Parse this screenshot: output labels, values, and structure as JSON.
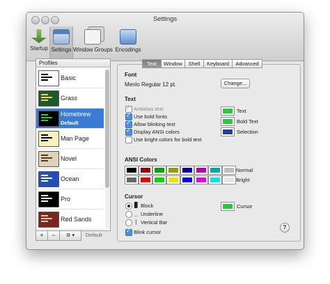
{
  "window": {
    "title": "Settings"
  },
  "toolbar": {
    "items": [
      {
        "label": "Startup",
        "icon": "startup-icon",
        "color": "#5a9a3a"
      },
      {
        "label": "Settings",
        "icon": "settings-icon",
        "color": "#4f7fc0",
        "selected": true
      },
      {
        "label": "Window Groups",
        "icon": "window-groups-icon",
        "color": "#8c8c8c"
      },
      {
        "label": "Encodings",
        "icon": "encodings-icon",
        "color": "#4d86c8"
      }
    ]
  },
  "profiles": {
    "header": "Profiles",
    "items": [
      {
        "name": "Basic",
        "bg": "#ffffff",
        "fg": "#000000"
      },
      {
        "name": "Grass",
        "bg": "#1d5a2b",
        "fg": "#f2d06b"
      },
      {
        "name": "Homebrew",
        "sub": "Default",
        "bg": "#000000",
        "fg": "#27c93f",
        "selected": true
      },
      {
        "name": "Man Page",
        "bg": "#fbf2b9",
        "fg": "#000000"
      },
      {
        "name": "Novel",
        "bg": "#ddd3b8",
        "fg": "#5a3a1a"
      },
      {
        "name": "Ocean",
        "bg": "#224fbc",
        "fg": "#ffffff"
      },
      {
        "name": "Pro",
        "bg": "#000000",
        "fg": "#f2f2f2"
      },
      {
        "name": "Red Sands",
        "bg": "#7a251e",
        "fg": "#d7c9a7"
      }
    ],
    "buttons": {
      "add": "+",
      "remove": "−",
      "gear": "⚙ ▾",
      "default": "Default"
    }
  },
  "tabs": [
    {
      "label": "Text",
      "selected": true
    },
    {
      "label": "Window"
    },
    {
      "label": "Shell"
    },
    {
      "label": "Keyboard"
    },
    {
      "label": "Advanced"
    }
  ],
  "font": {
    "heading": "Font",
    "value": "Menlo Regular 12 pt.",
    "change_label": "Change..."
  },
  "text": {
    "heading": "Text",
    "options": [
      {
        "label": "Antialias text",
        "checked": true,
        "disabled": true
      },
      {
        "label": "Use bold fonts",
        "checked": true
      },
      {
        "label": "Allow blinking text",
        "checked": true
      },
      {
        "label": "Display ANSI colors",
        "checked": true
      },
      {
        "label": "Use bright colors for bold text",
        "checked": false
      }
    ],
    "colors": [
      {
        "label": "Text",
        "color": "#27c93f"
      },
      {
        "label": "Bold Text",
        "color": "#27c93f"
      },
      {
        "label": "Selection",
        "color": "#1f3fa0"
      }
    ]
  },
  "ansi": {
    "heading": "ANSI Colors",
    "normal_label": "Normal",
    "bright_label": "Bright",
    "normal": [
      "#000000",
      "#990000",
      "#00a600",
      "#999900",
      "#0000b2",
      "#b200b2",
      "#00a6b2",
      "#bfbfbf"
    ],
    "bright": [
      "#666666",
      "#e50000",
      "#00d900",
      "#e5e500",
      "#0000ff",
      "#e500e5",
      "#00e5e5",
      "#e5e5e5"
    ]
  },
  "cursor": {
    "heading": "Cursor",
    "options": [
      {
        "label": "Block",
        "glyph": "█",
        "selected": true
      },
      {
        "label": "Underline",
        "glyph": "_",
        "selected": false
      },
      {
        "label": "Vertical Bar",
        "glyph": "|",
        "selected": false
      }
    ],
    "color_label": "Cursor",
    "color": "#27c93f",
    "blink_label": "Blink cursor",
    "blink": true
  },
  "help_label": "?"
}
